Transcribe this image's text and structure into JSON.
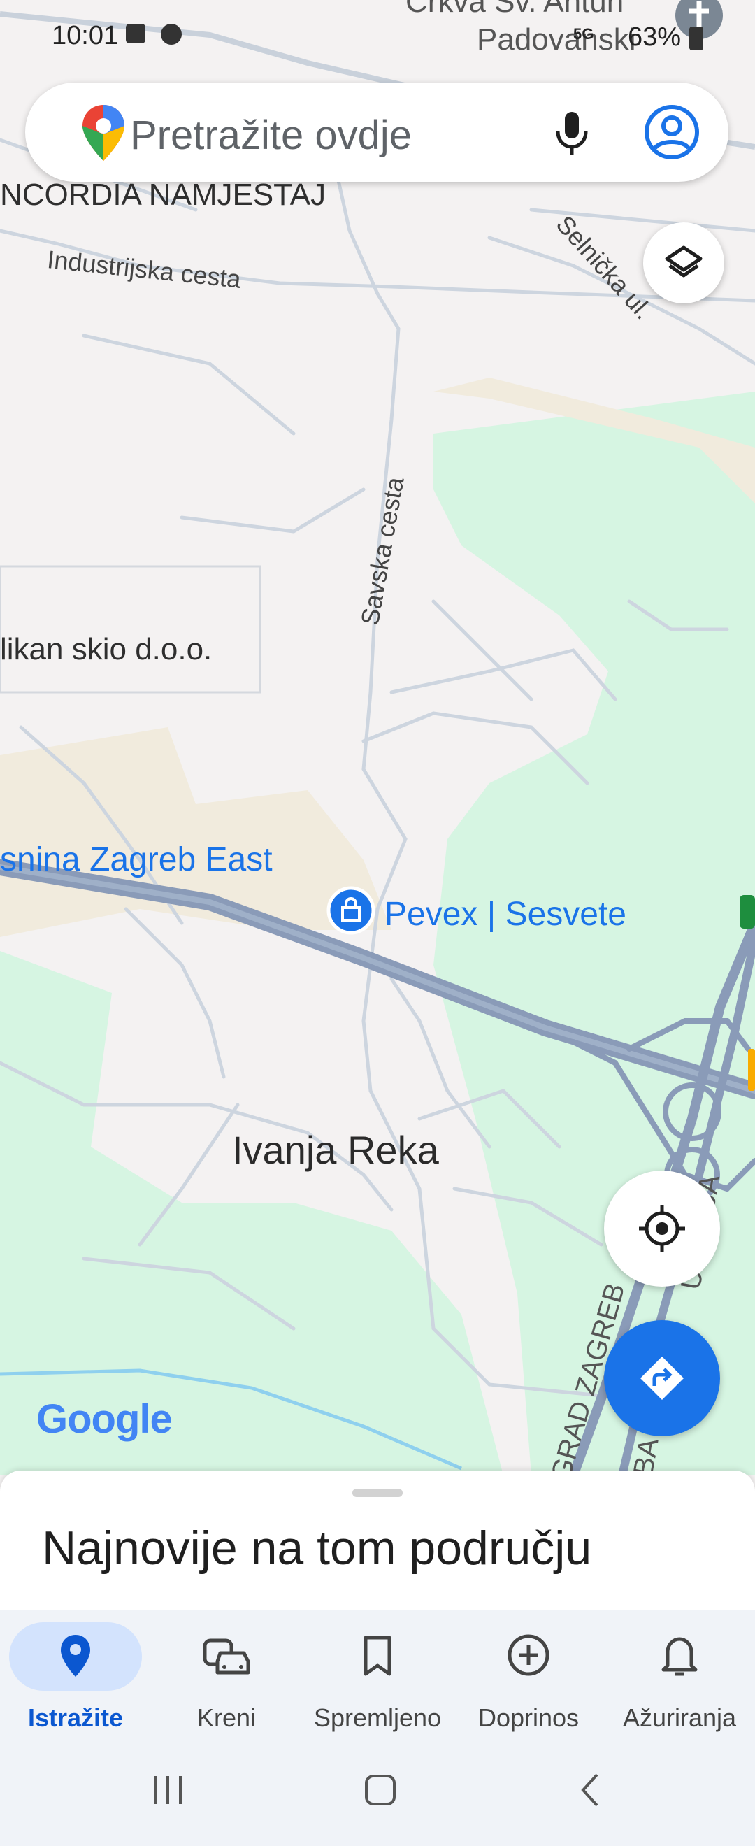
{
  "status_bar": {
    "time": "10:01",
    "battery": "63%",
    "network": "5G"
  },
  "search": {
    "placeholder": "Pretražite ovdje",
    "mic_icon": "mic-icon",
    "account_icon": "account-icon"
  },
  "map": {
    "labels": {
      "church_line1": "Crkva Sv. Antun",
      "church_line2": "Padovanski",
      "company1": "NCORDIA NAMJESTAJ",
      "road_industrijska": "Industrijska cesta",
      "road_selnicka": "Selnička ul.",
      "road_savska": "Savska cesta",
      "company2": "likan skio d.o.o.",
      "hotel": "snina Zagreb East",
      "store": "Pevex | Sesvete",
      "place": "Ivanja Reka",
      "road_grad": "GRAD ZAGREB",
      "road_ba": "BA",
      "road_upanija": "UPANIJA",
      "logo": "Google"
    },
    "colors": {
      "land": "#f4f2f2",
      "park": "#d6f5e2",
      "sand": "#f2ebdc",
      "road": "#c9d3df",
      "highway": "#8a9bb8",
      "water": "#8fd0ee",
      "accent": "#1a73e8"
    }
  },
  "buttons": {
    "layers_icon": "layers-icon",
    "location_icon": "my-location-icon",
    "directions_icon": "directions-icon"
  },
  "sheet": {
    "title": "Najnovije na tom području"
  },
  "bottom_nav": {
    "items": [
      {
        "label": "Istražite",
        "icon": "explore-pin-icon",
        "active": true
      },
      {
        "label": "Kreni",
        "icon": "commute-icon",
        "active": false
      },
      {
        "label": "Spremljeno",
        "icon": "bookmark-icon",
        "active": false
      },
      {
        "label": "Doprinos",
        "icon": "add-circle-icon",
        "active": false
      },
      {
        "label": "Ažuriranja",
        "icon": "bell-icon",
        "active": false
      }
    ]
  }
}
